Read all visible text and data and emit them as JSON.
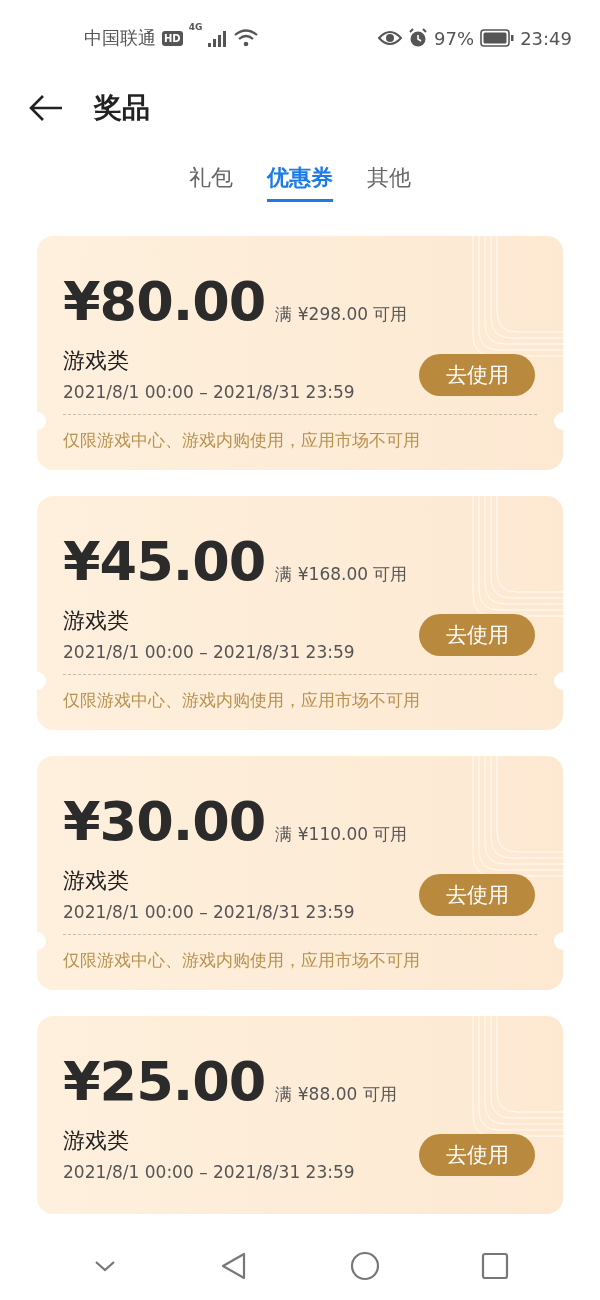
{
  "status_bar": {
    "carrier": "中国联通",
    "hd_badge": "HD",
    "network": "4G",
    "battery_percent": "97%",
    "time": "23:49"
  },
  "header": {
    "title": "奖品"
  },
  "tabs": [
    {
      "label": "礼包",
      "selected": false
    },
    {
      "label": "优惠券",
      "selected": true
    },
    {
      "label": "其他",
      "selected": false
    }
  ],
  "coupons": [
    {
      "amount": "¥80.00",
      "condition": "满 ¥298.00 可用",
      "category": "游戏类",
      "validity": "2021/8/1 00:00 – 2021/8/31 23:59",
      "action": "去使用",
      "note": "仅限游戏中心、游戏内购使用，应用市场不可用"
    },
    {
      "amount": "¥45.00",
      "condition": "满 ¥168.00 可用",
      "category": "游戏类",
      "validity": "2021/8/1 00:00 – 2021/8/31 23:59",
      "action": "去使用",
      "note": "仅限游戏中心、游戏内购使用，应用市场不可用"
    },
    {
      "amount": "¥30.00",
      "condition": "满 ¥110.00 可用",
      "category": "游戏类",
      "validity": "2021/8/1 00:00 – 2021/8/31 23:59",
      "action": "去使用",
      "note": "仅限游戏中心、游戏内购使用，应用市场不可用"
    },
    {
      "amount": "¥25.00",
      "condition": "满 ¥88.00 可用",
      "category": "游戏类",
      "validity": "2021/8/1 00:00 – 2021/8/31 23:59",
      "action": "去使用"
    }
  ]
}
